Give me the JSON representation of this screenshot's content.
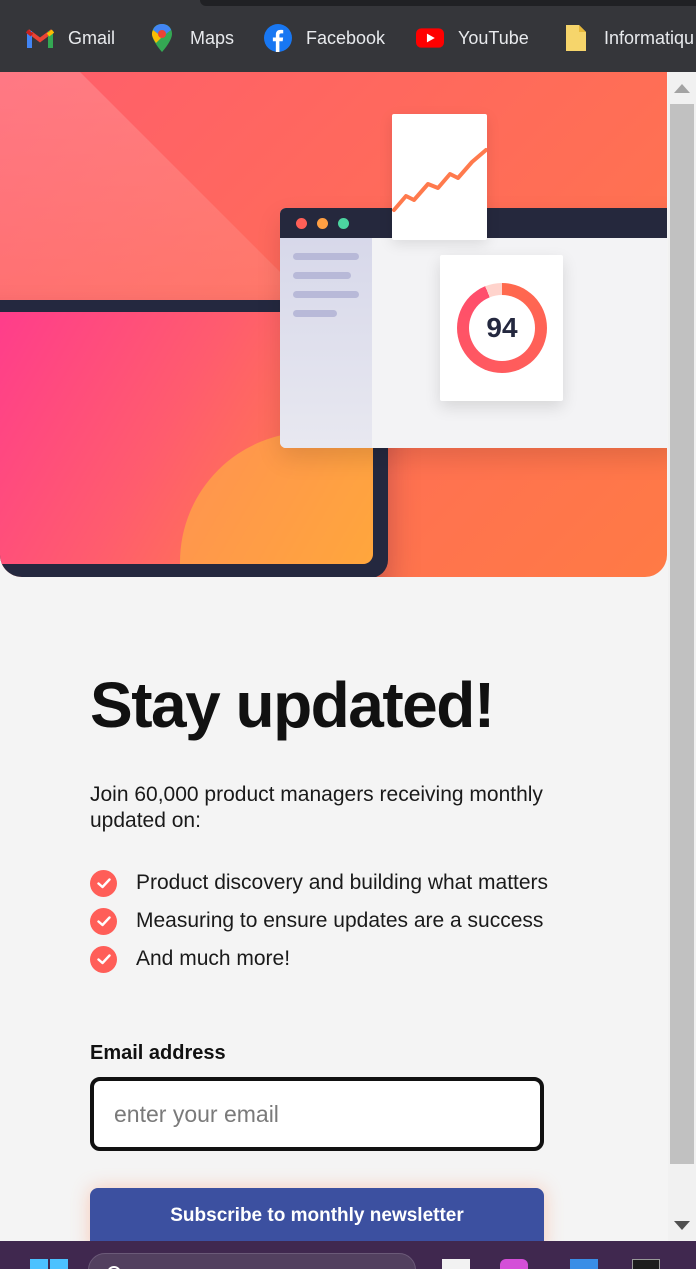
{
  "bookmarks": [
    {
      "label": "Gmail",
      "icon": "gmail-icon"
    },
    {
      "label": "Maps",
      "icon": "maps-icon"
    },
    {
      "label": "Facebook",
      "icon": "facebook-icon"
    },
    {
      "label": "YouTube",
      "icon": "youtube-icon"
    },
    {
      "label": "Informatiqu",
      "icon": "folder-icon"
    }
  ],
  "hero": {
    "score": "94"
  },
  "newsletter": {
    "title": "Stay updated!",
    "intro": "Join 60,000 product managers receiving monthly updated on:",
    "features": [
      "Product discovery and building what matters",
      "Measuring to ensure updates are a success",
      "And much more!"
    ],
    "email_label": "Email address",
    "email_placeholder": "enter your email",
    "email_value": "",
    "subscribe_label": "Subscribe to monthly newsletter"
  },
  "colors": {
    "accent": "#ff5e58",
    "button": "#3c50a0",
    "bookmarks_bar": "#35363a",
    "taskbar": "#40284f"
  }
}
